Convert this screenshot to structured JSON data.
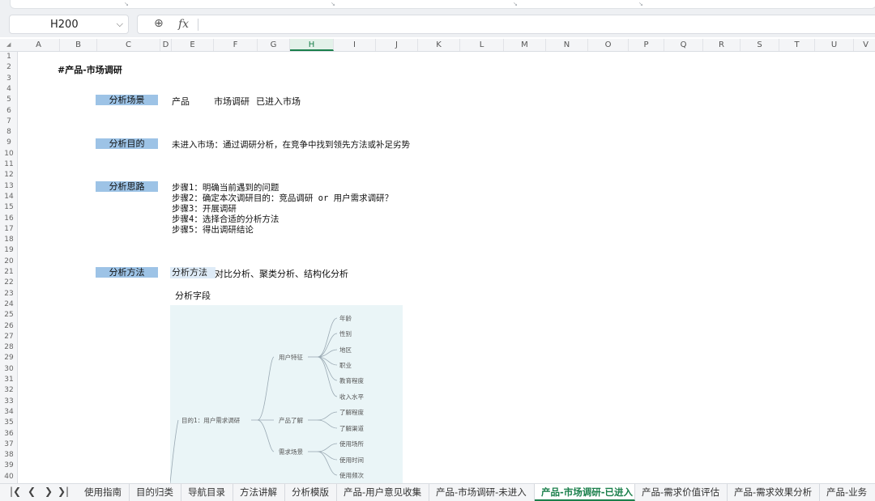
{
  "formula_bar": {
    "name_box": "H200",
    "fx_label": "fx",
    "formula": ""
  },
  "columns": [
    "A",
    "B",
    "C",
    "D",
    "E",
    "F",
    "G",
    "H",
    "I",
    "J",
    "K",
    "L",
    "M",
    "N",
    "O",
    "P",
    "Q",
    "R",
    "S",
    "T",
    "U",
    "V"
  ],
  "selected_column": "H",
  "rows": [
    "1",
    "2",
    "3",
    "4",
    "5",
    "6",
    "7",
    "8",
    "9",
    "10",
    "11",
    "12",
    "13",
    "14",
    "15",
    "16",
    "17",
    "18",
    "19",
    "20",
    "21",
    "22",
    "23",
    "24",
    "25",
    "26",
    "27",
    "28",
    "29",
    "30",
    "31",
    "32",
    "33",
    "34",
    "35",
    "36",
    "37",
    "38",
    "39",
    "40"
  ],
  "sheet": {
    "title": "#产品-市场调研",
    "scene": {
      "label": "分析场景",
      "v1": "产品",
      "v2": "市场调研",
      "v3": "已进入市场"
    },
    "purpose": {
      "label": "分析目的",
      "text": "未进入市场：通过调研分析，在竞争中找到领先方法或补足劣势"
    },
    "approach": {
      "label": "分析思路",
      "steps": [
        "步骤1：明确当前遇到的问题",
        "步骤2：确定本次调研目的：竞品调研 or 用户需求调研？",
        "步骤3：开展调研",
        "步骤4：选择合适的分析方法",
        "步骤5：得出调研结论"
      ]
    },
    "method": {
      "label": "分析方法",
      "chip": "分析方法",
      "text": "对比分析、聚类分析、结构化分析"
    },
    "fields_label": "分析字段",
    "mindmap": {
      "root": "目的1：用户需求调研",
      "branches": [
        "用户特征",
        "产品了解",
        "需求场景"
      ],
      "leaves": [
        "年龄",
        "性别",
        "地区",
        "职业",
        "教育程度",
        "收入水平",
        "了解程度",
        "了解渠道",
        "使用场所",
        "使用时间",
        "使用频次"
      ]
    }
  },
  "tabs": [
    "使用指南",
    "目的归类",
    "导航目录",
    "方法讲解",
    "分析模版",
    "产品-用户意见收集",
    "产品-市场调研-未进入",
    "产品-市场调研-已进入",
    "产品-需求价值评估",
    "产品-需求效果分析",
    "产品-业务"
  ],
  "active_tab": "产品-市场调研-已进入",
  "colors": {
    "label_fill": "#9dc3e6",
    "active_tab": "#1a7f4b",
    "mindmap_bg": "#eaf5f7"
  }
}
